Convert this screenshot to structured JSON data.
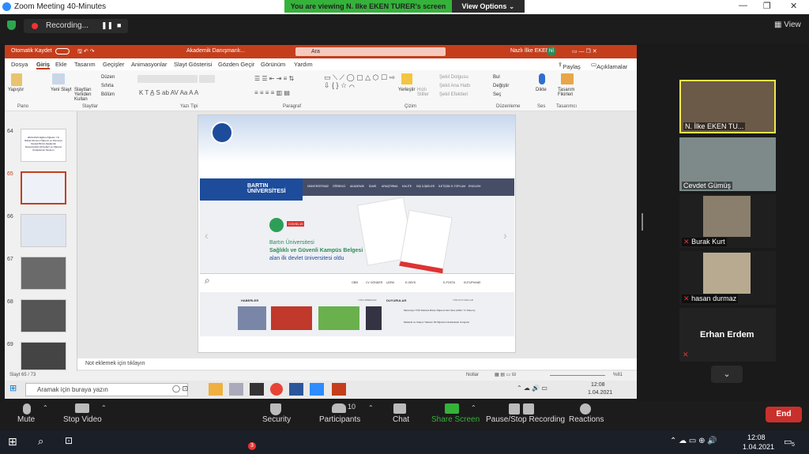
{
  "window": {
    "title": "Zoom Meeting 40-Minutes",
    "viewing_banner": "You are viewing N. Ilke EKEN TURER's screen",
    "view_options": "View Options"
  },
  "zoom_top": {
    "recording": "Recording...",
    "view": "View"
  },
  "ppt": {
    "autosave": "Otomatik Kaydet",
    "doc_title": "Akademik Danışmanlı...",
    "search_placeholder": "Ara",
    "user": "Nazlı İlke EKEN",
    "user_initials": "Nİ",
    "tabs": [
      "Dosya",
      "Giriş",
      "Ekle",
      "Tasarım",
      "Geçişler",
      "Animasyonlar",
      "Slayt Gösterisi",
      "Gözden Geçir",
      "Görünüm",
      "Yardım"
    ],
    "share": "Paylaş",
    "comments": "Açıklamalar",
    "ribbon_groups": {
      "clipboard": "Pano",
      "slides": "Slaytlar",
      "font": "Yazı Tipi",
      "paragraph": "Paragraf",
      "drawing": "Çizim",
      "editing": "Düzenleme",
      "voice": "Ses",
      "designer": "Tasarımcı"
    },
    "ribbon_labels": {
      "paste": "Yapıştır",
      "new_slide": "Yeni Slayt",
      "reuse": "Slaytları Yeniden Kullan",
      "layout": "Düzen",
      "reset": "Sıfırla",
      "section": "Bölüm",
      "shapes": "Şekiller",
      "arrange": "Yerleştir",
      "quick_styles": "Hızlı Stiller",
      "shape_fill": "Şekil Dolgusu",
      "shape_outline": "Şekil Ana Hattı",
      "shape_effects": "Şekil Efektleri",
      "find": "Bul",
      "replace": "Değiştir",
      "select": "Seç",
      "dictate": "Dikte",
      "design_ideas": "Tasarım Fikirleri"
    },
    "slide_numbers": [
      "64",
      "65",
      "66",
      "67",
      "68",
      "69"
    ],
    "thumb64_text": "2020-2021 Eğitim-Öğretim Yılı Bahar Dönemi Öğrenci ve Personel Destek Birimi Akademik Danışmanlık Hizmetleri ve Öğrenci Kulüplerinin Tanıtımı",
    "notes": "Not eklemek için tıklayın",
    "status_slide": "Slayt 65 / 73",
    "status_notes": "Notlar",
    "zoom_pct": "%81",
    "win_search": "Aramak için buraya yazın",
    "win_time": "12:08",
    "win_date": "1.04.2021"
  },
  "slide": {
    "site_name": "BARTIN ÜNİVERSİTESİ",
    "menu": [
      "ÜNİVERSİTEMİZ",
      "ÖĞRENCİ",
      "AKADEMİK",
      "İDARİ",
      "ARAŞTIRMA",
      "KALİTE",
      "DIŞ İLİŞKİLER",
      "İLETİŞİM",
      "E-TOPLUM",
      "ENGLISH"
    ],
    "badge": "COVID-19",
    "headline1": "Bartın Üniversitesi",
    "headline2": "Sağlıklı ve Güvenli Kampüs Belgesi",
    "headline3": "alan ilk devlet üniversitesi oldu",
    "quick": [
      "OBİS",
      "CV GÖNDER",
      "UZEM",
      "E-OBYS",
      "KÜTÜPHANE",
      "E-POSTA"
    ],
    "news": "HABERLER",
    "news_all": "TÜM HABERLER",
    "ann": "DUYURULAR",
    "ann_all": "TÜM DUYURULAR",
    "ann1": "Mezuniyet YÖK Doktora Bursu Öğrenci Alım İlanı (2021 / 3. Dönem)",
    "ann2": "Mekanik ve Ulaşım Yabancı Dil Öğretimi Uluslararası Kongresi"
  },
  "participants": [
    {
      "name": "N. İlke EKEN TU...",
      "muted": false
    },
    {
      "name": "Cevdet Gümüş",
      "muted": false
    },
    {
      "name": "Burak Kurt",
      "muted": true
    },
    {
      "name": "hasan durmaz",
      "muted": true
    },
    {
      "name": "Erhan Erdem",
      "muted": true
    }
  ],
  "zoom_controls": {
    "mute": "Mute",
    "video": "Stop Video",
    "security": "Security",
    "participants": "Participants",
    "participants_count": "10",
    "chat": "Chat",
    "share": "Share Screen",
    "record": "Pause/Stop Recording",
    "reactions": "Reactions",
    "end": "End"
  },
  "taskbar": {
    "time": "12:08",
    "date": "1.04.2021",
    "notif_count": "5",
    "wa_badge": "3"
  },
  "colors": {
    "zoom_green": "#35b23a",
    "ppt_red": "#c43e1c",
    "end_red": "#c9302c",
    "active_tile": "#f0e84a"
  }
}
